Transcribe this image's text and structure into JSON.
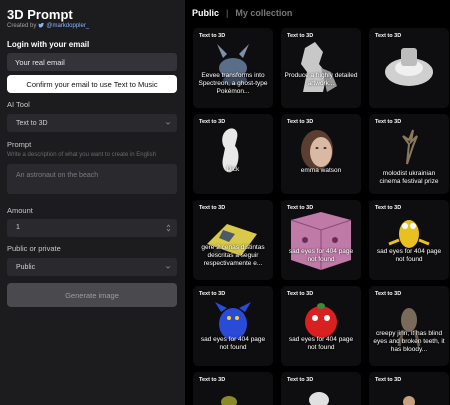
{
  "app": {
    "title": "3D Prompt",
    "created_by": "Created by",
    "author": "@markdoppler_"
  },
  "form": {
    "login_label": "Login with your email",
    "email_placeholder": "Your real email",
    "confirm_label": "Confirm your email to use Text to Music",
    "tool_label": "AI Tool",
    "tool_value": "Text to 3D",
    "prompt_label": "Prompt",
    "prompt_hint": "Write a description of what you want to create in English",
    "prompt_placeholder": "An astronaut on the beach",
    "amount_label": "Amount",
    "amount_value": "1",
    "privacy_label": "Public or private",
    "privacy_value": "Public",
    "generate_label": "Generate image"
  },
  "tabs": {
    "public": "Public",
    "separator": "|",
    "mine": "My collection"
  },
  "gallery": [
    {
      "tag": "Text to 3D",
      "caption": "Eevee transforms into Spectreon, a ghost-type Pokémon...",
      "art": "eevee"
    },
    {
      "tag": "Text to 3D",
      "caption": "Produce a highly detailed artwork...",
      "art": "statue"
    },
    {
      "tag": "Text to 3D",
      "caption": "",
      "art": "ring"
    },
    {
      "tag": "Text to 3D",
      "caption": "Dick",
      "art": "white-figure"
    },
    {
      "tag": "Text to 3D",
      "caption": "emma watson",
      "art": "face"
    },
    {
      "tag": "Text to 3D",
      "caption": "molodist ukrainian cinema festival prize",
      "art": "antler"
    },
    {
      "tag": "Text to 3D",
      "caption": "gere 2 cenas distintas descritas a seguir respectivamente e...",
      "art": "car"
    },
    {
      "tag": "Text to 3D",
      "caption": "sad eyes for 404 page not found",
      "art": "pink-cube"
    },
    {
      "tag": "Text to 3D",
      "caption": "sad eyes for 404 page not found",
      "art": "yellow-guy"
    },
    {
      "tag": "Text to 3D",
      "caption": "sad eyes for 404 page not found",
      "art": "blue-bird"
    },
    {
      "tag": "Text to 3D",
      "caption": "sad eyes for 404 page not found",
      "art": "red-ball"
    },
    {
      "tag": "Text to 3D",
      "caption": "creepy jinn, it has blind eyes and broken teeth, it has bloody...",
      "art": "creepy"
    },
    {
      "tag": "Text to 3D",
      "caption": "",
      "art": "bottom1"
    },
    {
      "tag": "Text to 3D",
      "caption": "",
      "art": "bottom2"
    },
    {
      "tag": "Text to 3D",
      "caption": "",
      "art": "bottom3"
    }
  ],
  "colors": {
    "panel": "#1c1c1e",
    "background": "#000000",
    "field": "#2a2a2e",
    "link": "#8ab4f8"
  },
  "icons": {
    "author_icon": "twitter-bird-icon",
    "select_icon": "chevron-down-icon",
    "amount_icon": "stepper-arrows-icon"
  }
}
